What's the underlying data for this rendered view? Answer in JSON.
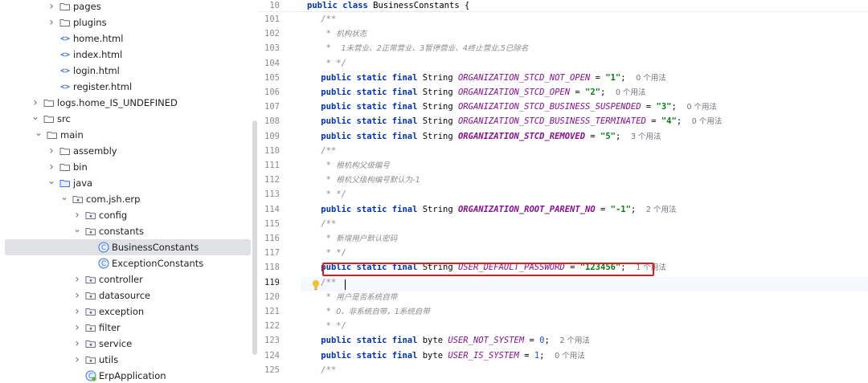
{
  "project_tree": {
    "items": [
      {
        "label": "pages",
        "kind": "folder",
        "expanded": false,
        "depth": 2
      },
      {
        "label": "plugins",
        "kind": "folder",
        "expanded": false,
        "depth": 2
      },
      {
        "label": "home.html",
        "kind": "html",
        "depth": 2
      },
      {
        "label": "index.html",
        "kind": "html",
        "depth": 2
      },
      {
        "label": "login.html",
        "kind": "html",
        "depth": 2
      },
      {
        "label": "register.html",
        "kind": "html",
        "depth": 2
      },
      {
        "label": "logs.home_IS_UNDEFINED",
        "kind": "folder",
        "expanded": false,
        "depth": 0
      },
      {
        "label": "src",
        "kind": "folder",
        "expanded": true,
        "depth": 0
      },
      {
        "label": "main",
        "kind": "folder",
        "expanded": true,
        "depth": 1
      },
      {
        "label": "assembly",
        "kind": "folder",
        "expanded": false,
        "depth": 2
      },
      {
        "label": "bin",
        "kind": "folder",
        "expanded": false,
        "depth": 2
      },
      {
        "label": "java",
        "kind": "source-folder",
        "expanded": true,
        "depth": 2
      },
      {
        "label": "com.jsh.erp",
        "kind": "package",
        "expanded": true,
        "depth": 3
      },
      {
        "label": "config",
        "kind": "package",
        "expanded": false,
        "depth": 4
      },
      {
        "label": "constants",
        "kind": "package",
        "expanded": true,
        "depth": 4
      },
      {
        "label": "BusinessConstants",
        "kind": "class",
        "depth": 5,
        "selected": true
      },
      {
        "label": "ExceptionConstants",
        "kind": "class",
        "depth": 5
      },
      {
        "label": "controller",
        "kind": "package",
        "expanded": false,
        "depth": 4
      },
      {
        "label": "datasource",
        "kind": "package",
        "expanded": false,
        "depth": 4
      },
      {
        "label": "exception",
        "kind": "package",
        "expanded": false,
        "depth": 4
      },
      {
        "label": "filter",
        "kind": "package",
        "expanded": false,
        "depth": 4
      },
      {
        "label": "service",
        "kind": "package",
        "expanded": false,
        "depth": 4
      },
      {
        "label": "utils",
        "kind": "package",
        "expanded": false,
        "depth": 4
      },
      {
        "label": "ErpApplication",
        "kind": "spring-class",
        "depth": 4
      }
    ]
  },
  "editor": {
    "sticky_header": {
      "line": "10",
      "code": "public class BusinessConstants {"
    },
    "current_line": "119",
    "lines": [
      {
        "n": "101",
        "t": "comment",
        "text": "    /**"
      },
      {
        "n": "102",
        "t": "comment-cn",
        "prefix": "     * ",
        "text": "机构状态"
      },
      {
        "n": "103",
        "t": "comment-cn",
        "prefix": "     *  ",
        "text": "1未营业、2正常营业、3暂停营业、4终止营业,5已除名"
      },
      {
        "n": "104",
        "t": "comment",
        "text": "     * */"
      },
      {
        "n": "105",
        "t": "const",
        "type": "String",
        "name": "ORGANIZATION_STCD_NOT_OPEN",
        "value": "\"1\"",
        "vkind": "str",
        "hint": "0 个用法"
      },
      {
        "n": "106",
        "t": "const",
        "type": "String",
        "name": "ORGANIZATION_STCD_OPEN",
        "value": "\"2\"",
        "vkind": "str",
        "hint": "0 个用法"
      },
      {
        "n": "107",
        "t": "const",
        "type": "String",
        "name": "ORGANIZATION_STCD_BUSINESS_SUSPENDED",
        "value": "\"3\"",
        "vkind": "str",
        "hint": "0 个用法"
      },
      {
        "n": "108",
        "t": "const",
        "type": "String",
        "name": "ORGANIZATION_STCD_BUSINESS_TERMINATED",
        "value": "\"4\"",
        "vkind": "str",
        "hint": "0 个用法"
      },
      {
        "n": "109",
        "t": "const",
        "type": "String",
        "name": "ORGANIZATION_STCD_REMOVED",
        "value": "\"5\"",
        "vkind": "str",
        "hint": "3 个用法",
        "bold": true
      },
      {
        "n": "110",
        "t": "comment",
        "text": "    /**"
      },
      {
        "n": "111",
        "t": "comment-cn",
        "prefix": "     * ",
        "text": "根机构父级编号"
      },
      {
        "n": "112",
        "t": "comment-cn",
        "prefix": "     * ",
        "text": "根机父级构编号默认为-1"
      },
      {
        "n": "113",
        "t": "comment",
        "text": "     * */"
      },
      {
        "n": "114",
        "t": "const",
        "type": "String",
        "name": "ORGANIZATION_ROOT_PARENT_NO",
        "value": "\"-1\"",
        "vkind": "str",
        "hint": "2 个用法",
        "bold": true
      },
      {
        "n": "115",
        "t": "comment",
        "text": "    /**"
      },
      {
        "n": "116",
        "t": "comment-cn",
        "prefix": "     * ",
        "text": "新增用户默认密码"
      },
      {
        "n": "117",
        "t": "comment",
        "text": "     * */"
      },
      {
        "n": "118",
        "t": "const",
        "type": "String",
        "name": "USER_DEFAULT_PASSWORD",
        "value": "\"123456\"",
        "vkind": "str",
        "hint": "1 个用法"
      },
      {
        "n": "119",
        "t": "comment",
        "text": "    /**"
      },
      {
        "n": "120",
        "t": "comment-cn",
        "prefix": "     * ",
        "text": "用户是否系统自带"
      },
      {
        "n": "121",
        "t": "comment-cn",
        "prefix": "     * ",
        "text": "0、非系统自带，1系统自带"
      },
      {
        "n": "122",
        "t": "comment",
        "text": "     * */"
      },
      {
        "n": "123",
        "t": "const",
        "type": "byte",
        "name": "USER_NOT_SYSTEM",
        "value": "0",
        "vkind": "num",
        "hint": "2 个用法"
      },
      {
        "n": "124",
        "t": "const",
        "type": "byte",
        "name": "USER_IS_SYSTEM",
        "value": "1",
        "vkind": "num",
        "hint": "0 个用法"
      },
      {
        "n": "125",
        "t": "comment",
        "text": "    /**"
      }
    ],
    "keywords": {
      "public": "public",
      "static": "static",
      "final": "final"
    }
  },
  "colors": {
    "keyword": "#0033b3",
    "constant": "#871094",
    "string": "#067d17",
    "number": "#1750eb",
    "comment": "#8c8c8c",
    "highlight": "#e21a1a"
  },
  "icons": {
    "folder": "folder-icon",
    "package": "package-icon",
    "class": "class-icon",
    "html": "html-file-icon",
    "intention": "lightbulb-icon"
  }
}
